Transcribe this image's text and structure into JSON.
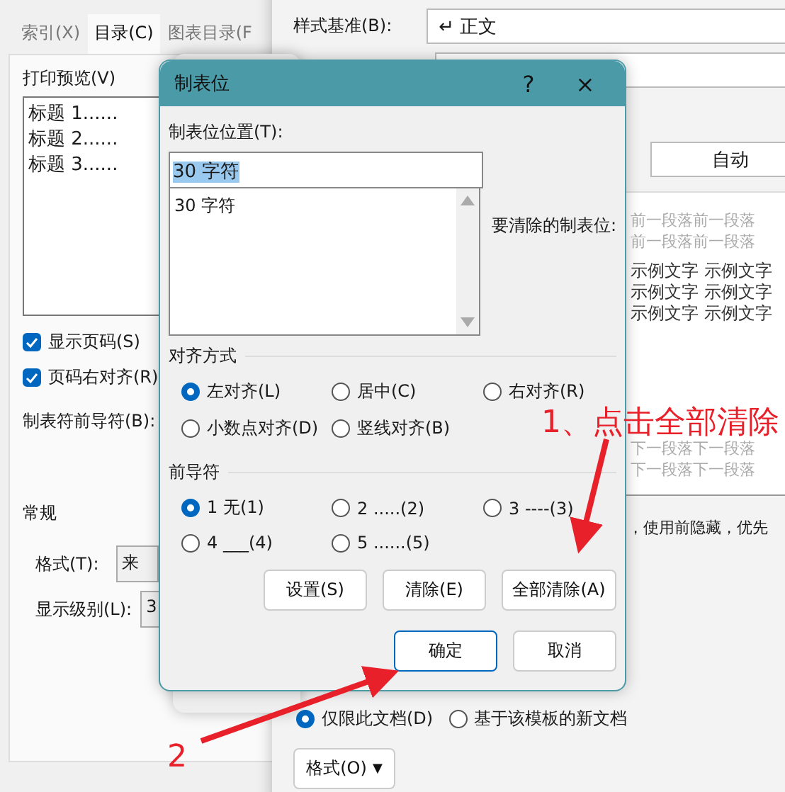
{
  "toc_dialog": {
    "tabs": [
      {
        "label": "索引(X)",
        "selected": false
      },
      {
        "label": "目录(C)",
        "selected": true
      },
      {
        "label": "图表目录(F",
        "selected": false
      }
    ],
    "preview_label": "打印预览(V)",
    "preview_lines": [
      "标题 1......",
      "标题 2......",
      "标题 3......"
    ],
    "checkboxes": [
      {
        "label": "显示页码(S)",
        "checked": true
      },
      {
        "label": "页码右对齐(R)",
        "checked": true
      }
    ],
    "leader_label": "制表符前导符(B):",
    "general_label": "常规",
    "format_label": "格式(T):",
    "format_value": "来",
    "level_label": "显示级别(L):",
    "level_value": "3"
  },
  "style_dialog": {
    "base_label": "样式基准(B):",
    "base_value": "↵ 正文",
    "color_value": "自动",
    "preview_before": [
      "前一段落前一段落",
      "前一段落前一段落"
    ],
    "preview_sample": [
      "示例文字 示例文字",
      "示例文字 示例文字",
      "示例文字 示例文字"
    ],
    "preview_after": [
      "下一段落下一段落",
      "下一段落下一段落"
    ],
    "description": "，使用前隐藏，优先",
    "scope": [
      {
        "label": "仅限此文档(D)",
        "selected": true
      },
      {
        "label": "基于该模板的新文档",
        "selected": false
      }
    ],
    "format_button": "格式(O)",
    "format_caret": "▼"
  },
  "tab_dialog": {
    "title": "制表位",
    "help": "?",
    "close": "×",
    "position_label": "制表位位置(T):",
    "position_value": "30 字符",
    "positions": [
      "30 字符"
    ],
    "clear_label": "要清除的制表位:",
    "alignment_label": "对齐方式",
    "alignment": [
      {
        "label": "左对齐(L)",
        "selected": true
      },
      {
        "label": "居中(C)",
        "selected": false
      },
      {
        "label": "右对齐(R)",
        "selected": false
      },
      {
        "label": "小数点对齐(D)",
        "selected": false
      },
      {
        "label": "竖线对齐(B)",
        "selected": false
      }
    ],
    "leader_label": "前导符",
    "leaders": [
      {
        "label": "1 无(1)",
        "selected": true
      },
      {
        "label": "2 .....(2)",
        "selected": false
      },
      {
        "label": "3 ----(3)",
        "selected": false
      },
      {
        "label": "4 ___(4)",
        "selected": false
      },
      {
        "label": "5 ......(5)",
        "selected": false
      }
    ],
    "action_buttons": [
      "设置(S)",
      "清除(E)",
      "全部清除(A)"
    ],
    "ok": "确定",
    "cancel": "取消"
  },
  "annotations": [
    {
      "text": "1、点击全部清除"
    },
    {
      "text": "2"
    }
  ]
}
